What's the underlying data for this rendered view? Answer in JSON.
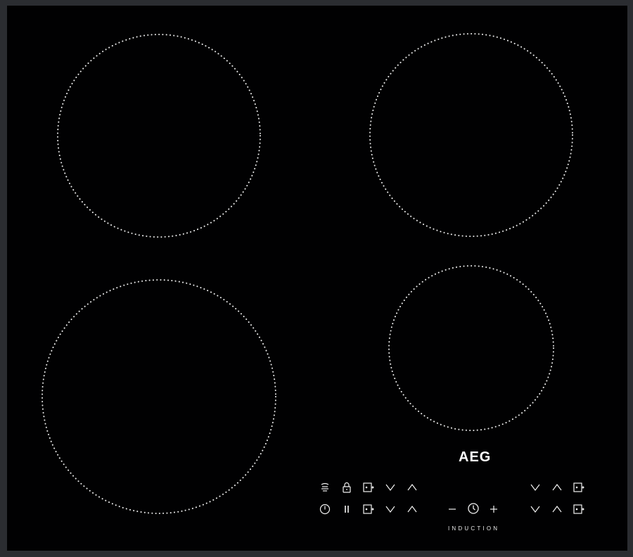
{
  "brand": "AEG",
  "technology_label": "INDUCTION",
  "colors": {
    "glass": "#010102",
    "frame": "#2b2d31",
    "zone_outline": "#e6e6e6",
    "controls": "#f2f2f2"
  },
  "cooking_zones": [
    {
      "name": "rear-left"
    },
    {
      "name": "rear-right"
    },
    {
      "name": "front-left"
    },
    {
      "name": "front-right"
    }
  ],
  "controls": {
    "top_row": [
      "hob2hood-icon",
      "lock-icon",
      "timer-icon",
      "chevron-down-icon",
      "chevron-up-icon",
      "chevron-down-icon",
      "chevron-up-icon",
      "timer-icon"
    ],
    "bottom_row": [
      "power-icon",
      "pause-icon",
      "timer-icon",
      "chevron-down-icon",
      "chevron-up-icon",
      "minus-icon",
      "clock-icon",
      "plus-icon",
      "chevron-down-icon",
      "chevron-up-icon",
      "timer-icon"
    ]
  }
}
